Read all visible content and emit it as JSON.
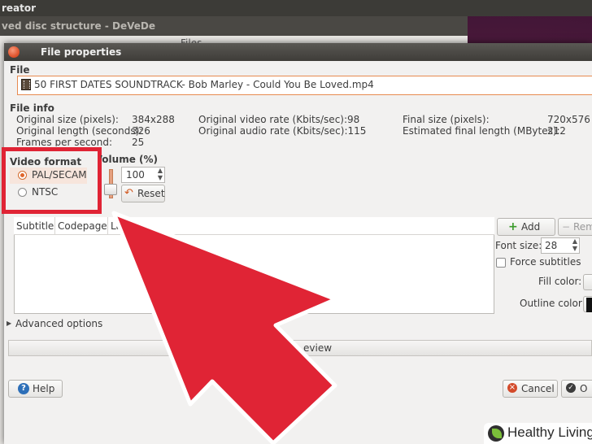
{
  "app_bar": {
    "title": "reator"
  },
  "bg_window": {
    "title": "ved disc structure - DeVeDe",
    "files_label": "Files"
  },
  "dialog": {
    "title": "File properties",
    "file_section": {
      "label": "File",
      "filename": "50 FIRST DATES SOUNDTRACK- Bob Marley  - Could You Be Loved.mp4"
    },
    "file_info": {
      "label": "File info",
      "rows": [
        [
          "Original size (pixels):",
          "384x288",
          "Original video rate (Kbits/sec):98",
          "Final size (pixels):",
          "720x576"
        ],
        [
          "Original length (seconds):",
          "326",
          "Original audio rate (Kbits/sec):115",
          "Estimated final length (MBytes):",
          "212"
        ],
        [
          "Frames per second:",
          "25",
          "",
          "",
          ""
        ]
      ]
    },
    "video_format": {
      "label": "Video format",
      "options": [
        "PAL/SECAM",
        "NTSC"
      ],
      "selected": "PAL/SECAM"
    },
    "volume": {
      "label": "Volume (%)",
      "value": "100",
      "reset_label": "Reset"
    },
    "subtitles": {
      "columns": [
        "Subtitle",
        "Codepage",
        "La"
      ],
      "add_label": "Add",
      "remove_label": "Rem",
      "font_size_label": "Font size:",
      "font_size_value": "28",
      "force_label": "Force subtitles",
      "fill_color_label": "Fill color:",
      "outline_color_label": "Outline color:",
      "outline_color": "#111111",
      "fill_color": "#ffffff"
    },
    "advanced_label": "Advanced options",
    "preview_label": "eview",
    "help_label": "Help",
    "cancel_label": "Cancel",
    "ok_label": "O"
  },
  "annotation": {
    "arrow_color": "#e02435",
    "frame_color": "#e02435"
  },
  "watermark": {
    "text": "Healthy Living"
  }
}
